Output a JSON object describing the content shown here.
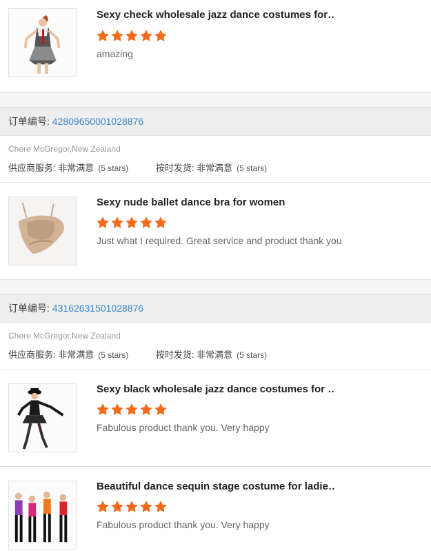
{
  "colors": {
    "star": "#f26b1d",
    "order_number": "#3b87c8"
  },
  "icons": {
    "rating": "star-icon"
  },
  "products": [
    {
      "title": "Sexy check wholesale jazz dance costumes for…",
      "rating": 5,
      "comment": "amazing",
      "image": "dancer-check-costume"
    },
    {
      "title": "Sexy nude ballet dance bra for women",
      "rating": 5,
      "comment": "Just what I required. Great service and product thank you",
      "image": "nude-ballet-bra"
    },
    {
      "title": "Sexy black wholesale jazz dance costumes for …",
      "rating": 5,
      "comment": "Fabulous product thank you. Very happy",
      "image": "black-jazz-costume"
    },
    {
      "title": "Beautiful dance sequin stage costume for ladie…",
      "rating": 5,
      "comment": "Fabulous product thank you. Very happy",
      "image": "sequin-stage-costume"
    }
  ],
  "orders": [
    {
      "label": "订单编号: ",
      "number": "42809650001028876",
      "reviewer": "Chere McGregor,New Zealand",
      "service_label": "供应商服务: ",
      "service_value": "非常满意",
      "service_stars": "(5 stars)",
      "delivery_label": "按时发货: ",
      "delivery_value": "非常满意",
      "delivery_stars": "(5 stars)"
    },
    {
      "label": "订单编号: ",
      "number": "43162631501028876",
      "reviewer": "Chere McGregor,New Zealand",
      "service_label": "供应商服务: ",
      "service_value": "非常满意",
      "service_stars": "(5 stars)",
      "delivery_label": "按时发货: ",
      "delivery_value": "非常满意",
      "delivery_stars": "(5 stars)"
    }
  ]
}
